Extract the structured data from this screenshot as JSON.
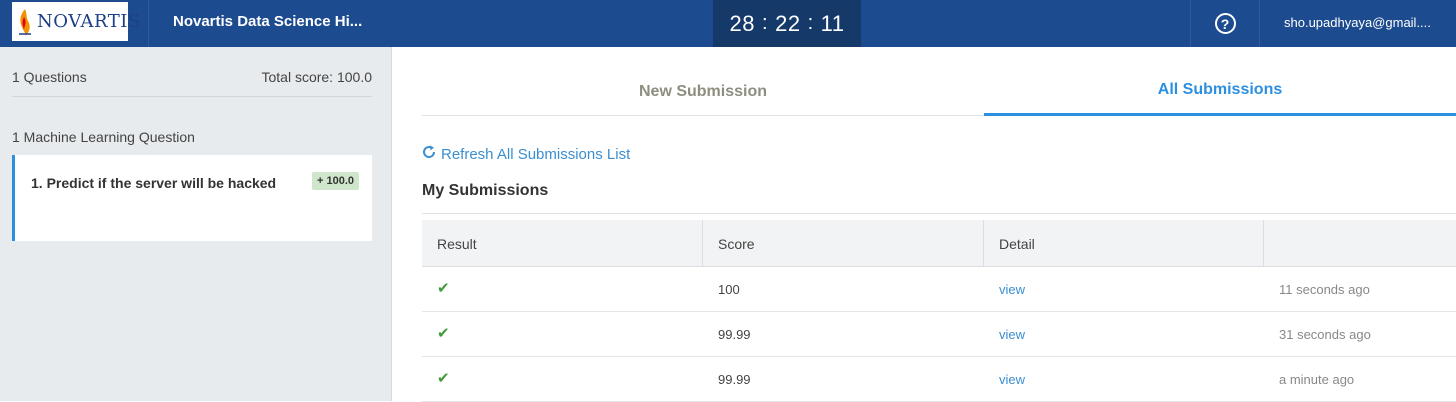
{
  "header": {
    "logo_text": "NOVARTIS",
    "contest_title": "Novartis Data Science Hi...",
    "timer": {
      "hours": "28",
      "minutes": "22",
      "seconds": "11"
    },
    "user_email": "sho.upadhyaya@gmail...."
  },
  "sidebar": {
    "question_count": "1 Questions",
    "total_score": "Total score: 100.0",
    "section_label": "1 Machine Learning Question",
    "questions": [
      {
        "title": "1. Predict if the server will be hacked",
        "badge": "+ 100.0"
      }
    ]
  },
  "tabs": {
    "new": "New Submission",
    "all": "All Submissions"
  },
  "main": {
    "refresh_label": "Refresh All Submissions List",
    "section_title": "My Submissions",
    "columns": [
      "Result",
      "Score",
      "Detail",
      ""
    ],
    "rows": [
      {
        "score": "100",
        "detail": "view",
        "time": "11 seconds ago"
      },
      {
        "score": "99.99",
        "detail": "view",
        "time": "31 seconds ago"
      },
      {
        "score": "99.99",
        "detail": "view",
        "time": "a minute ago"
      }
    ]
  },
  "colors": {
    "header_bg": "#1d4b8f",
    "timer_bg": "#153969",
    "accent": "#2d8fe0",
    "success": "#3f9b3c"
  }
}
